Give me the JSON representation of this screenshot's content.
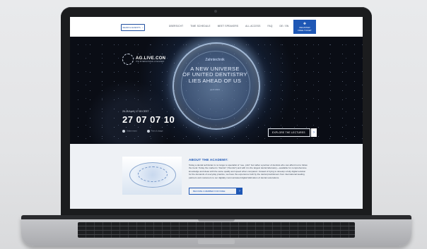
{
  "nav": {
    "search_label": "SEARCH EVENTS",
    "links": [
      "ÜBERSICHT",
      "TIME SCHEDULE",
      "MEET SPEAKERS",
      "ALL ACCESS",
      "FAQ",
      "DE / EN"
    ],
    "cta_line1": "REGISTER",
    "cta_line2": "FREE TICKET"
  },
  "hero": {
    "logo_text": "AG.LIVE.CON",
    "logo_sub": "THE INTERNATIONAL LIVE EVENT",
    "ring_subtitle": "Zahntechnik",
    "ring_heading_1": "A NEW UNIVERSE",
    "ring_heading_2": "OF UNITED DENTISTRY",
    "ring_heading_3": "LIES AHEAD OF US",
    "ring_date": "April 2024",
    "countdown_label": "26-28 April | 17:00 CEST",
    "countdown": "27 07 07 10",
    "legend_1": "Online event",
    "legend_2": "Free of charge",
    "explore_label": "EXPLORE THE LECTURES",
    "arrow": "›"
  },
  "about": {
    "title": "ABOUT THE ACADEMY:",
    "body": "Today a dental technician is no longer a specialist of “see, print” but rather a partner of dentists who can afford not to follow the trend. Today the market is “Dentist” (“Dentist”) and with it is the largest dental laboratory—available for comprehensive knowledge and ideas with the same quality and speed when compared. Instead of trying to develop a fully digital solution for the demands of everyday practice, we have the experience built by the dental practitioners from international leading partners and customers to our digitally communicated digital fabrication of dental restorations.",
    "button_label": "BECOME A MEMBER FOR FREE",
    "arrow": "›"
  },
  "colors": {
    "accent": "#1e57b5",
    "hero_bg": "#0a0d15",
    "section_bg": "#eef1f5"
  }
}
